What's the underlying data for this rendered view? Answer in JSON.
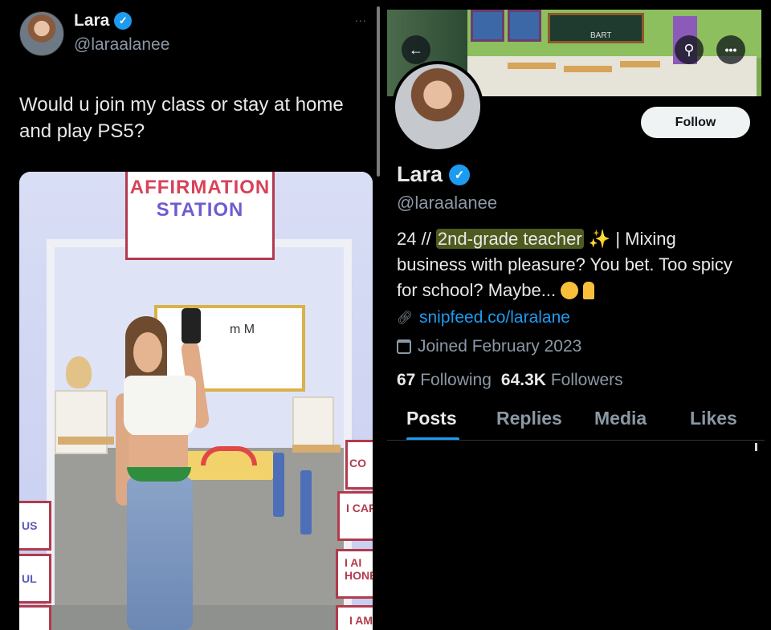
{
  "tweet": {
    "name": "Lara",
    "verified_mark": "✓",
    "handle": "@laraalanee",
    "more_label": "...",
    "text": "Would u join my class or stay at home and play PS5?",
    "photo": {
      "sign_line1": "AFFIRMATION",
      "sign_line2": "STATION",
      "board_text": "m M",
      "cards": [
        "US",
        "UL",
        "CO",
        "I CAP",
        "I AI HONE",
        "I AM"
      ]
    }
  },
  "profile": {
    "banner_board_text": "BART",
    "back_label": "←",
    "search_label": "⚲",
    "more_label": "•••",
    "follow_label": "Follow",
    "name": "Lara",
    "verified_mark": "✓",
    "handle": "@laraalanee",
    "bio_prefix": "24 // ",
    "bio_highlight": "2nd-grade teacher",
    "bio_sparkle": " ✨",
    "bio_rest": " | Mixing business with pleasure? You bet. Too spicy for school? Maybe... ",
    "link_icon": "link-icon",
    "link_text": "snipfeed.co/laralane",
    "calendar_icon": "calendar-icon",
    "joined_text": "Joined February 2023",
    "following_count": "67",
    "following_label": "Following",
    "followers_count": "64.3K",
    "followers_label": "Followers",
    "tabs": [
      "Posts",
      "Replies",
      "Media",
      "Likes"
    ],
    "active_tab": "Posts"
  },
  "colors": {
    "background": "#000000",
    "accent": "#1d9bf0",
    "text_primary": "#e7e9ea",
    "text_secondary": "#8b98a5",
    "highlight": "#4f5a1e"
  }
}
